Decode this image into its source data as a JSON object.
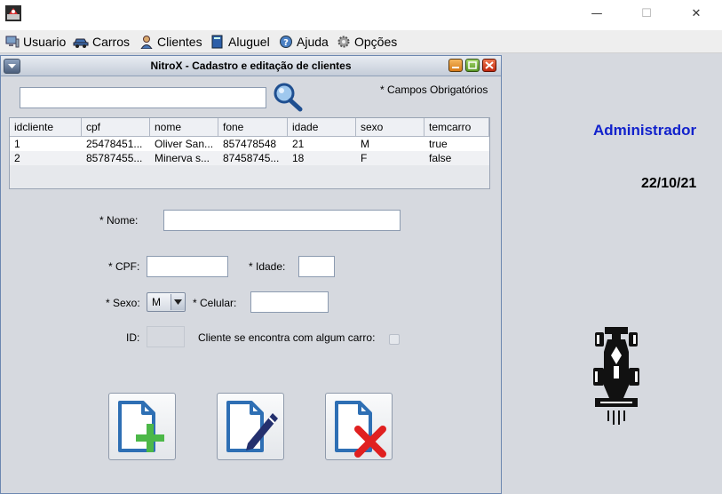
{
  "menubar": {
    "items": [
      {
        "label": "Usuario",
        "icon": "computer-icon"
      },
      {
        "label": "Carros",
        "icon": "car-icon"
      },
      {
        "label": "Clientes",
        "icon": "person-icon"
      },
      {
        "label": "Aluguel",
        "icon": "book-icon"
      },
      {
        "label": "Ajuda",
        "icon": "help-icon"
      },
      {
        "label": "Opções",
        "icon": "gear-icon"
      }
    ]
  },
  "window_controls": {
    "minimize": "—",
    "maximize": "☐",
    "close": "✕"
  },
  "internal_frame": {
    "title": "NitroX - Cadastro e editação de clientes"
  },
  "search": {
    "value": ""
  },
  "required_note": "* Campos Obrigatórios",
  "table": {
    "columns": [
      "idcliente",
      "cpf",
      "nome",
      "fone",
      "idade",
      "sexo",
      "temcarro"
    ],
    "rows": [
      [
        "1",
        "25478451...",
        "Oliver San...",
        "857478548",
        "21",
        "M",
        "true"
      ],
      [
        "2",
        "85787455...",
        "Minerva s...",
        "87458745...",
        "18",
        "F",
        "false"
      ]
    ]
  },
  "form": {
    "nome_label": "* Nome:",
    "cpf_label": "* CPF:",
    "idade_label": "* Idade:",
    "sexo_label": "* Sexo:",
    "sexo_value": "M",
    "celular_label": "* Celular:",
    "id_label": "ID:",
    "carro_label": "Cliente se encontra com algum carro:",
    "nome_value": "",
    "cpf_value": "",
    "idade_value": "",
    "celular_value": "",
    "id_value": ""
  },
  "side": {
    "user": "Administrador",
    "date": "22/10/21"
  },
  "colors": {
    "accent_blue": "#1222cc",
    "add_green": "#4cb848",
    "delete_red": "#e02020",
    "doc_blue": "#2e6fb4"
  }
}
